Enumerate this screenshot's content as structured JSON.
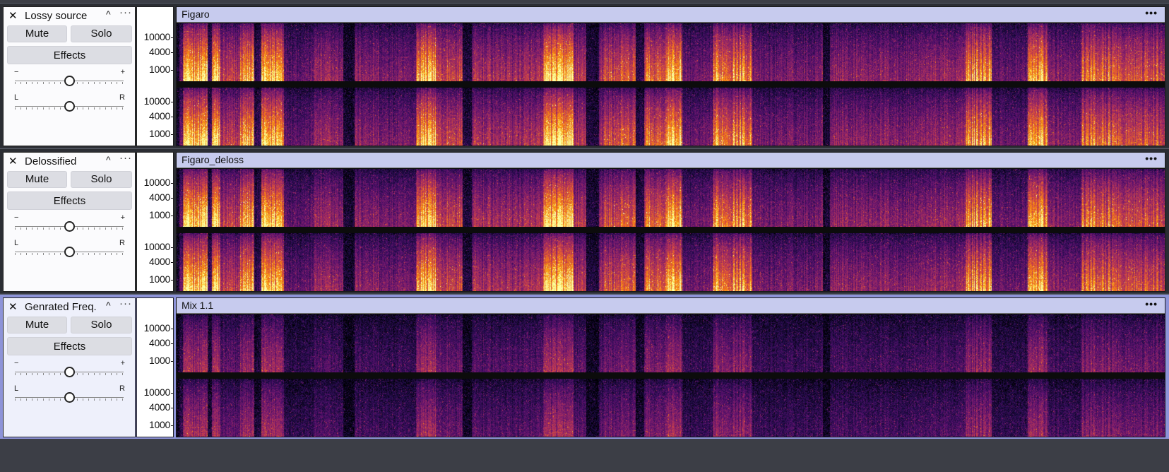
{
  "tracks": [
    {
      "name": "Lossy source",
      "clip": "Figaro",
      "mute_label": "Mute",
      "solo_label": "Solo",
      "effects_label": "Effects",
      "gain_minus": "−",
      "gain_plus": "+",
      "pan_left": "L",
      "pan_right": "R",
      "gain_level": 0.5,
      "pan_level": 0.5,
      "selected": false,
      "brightness": 1.0
    },
    {
      "name": "Delossified",
      "clip": "Figaro_deloss",
      "mute_label": "Mute",
      "solo_label": "Solo",
      "effects_label": "Effects",
      "gain_minus": "−",
      "gain_plus": "+",
      "pan_left": "L",
      "pan_right": "R",
      "gain_level": 0.5,
      "pan_level": 0.5,
      "selected": false,
      "brightness": 1.0
    },
    {
      "name": "Genrated Freq.",
      "clip": "Mix 1.1",
      "mute_label": "Mute",
      "solo_label": "Solo",
      "effects_label": "Effects",
      "gain_minus": "−",
      "gain_plus": "+",
      "pan_left": "L",
      "pan_right": "R",
      "gain_level": 0.5,
      "pan_level": 0.5,
      "selected": true,
      "brightness": 0.55
    }
  ],
  "ruler_ticks": [
    "10000",
    "4000",
    "1000"
  ],
  "icons": {
    "close": "close-icon",
    "collapse": "chevron-up-icon",
    "track_menu": "more-icon",
    "clip_menu": "more-icon"
  },
  "glyphs": {
    "close": "✕",
    "collapse": "^",
    "track_menu": "···",
    "clip_menu": "•••"
  },
  "colors": {
    "selected_track": "#8d93d8",
    "clip_title": "#c7cbee",
    "background": "#3c3e46"
  }
}
